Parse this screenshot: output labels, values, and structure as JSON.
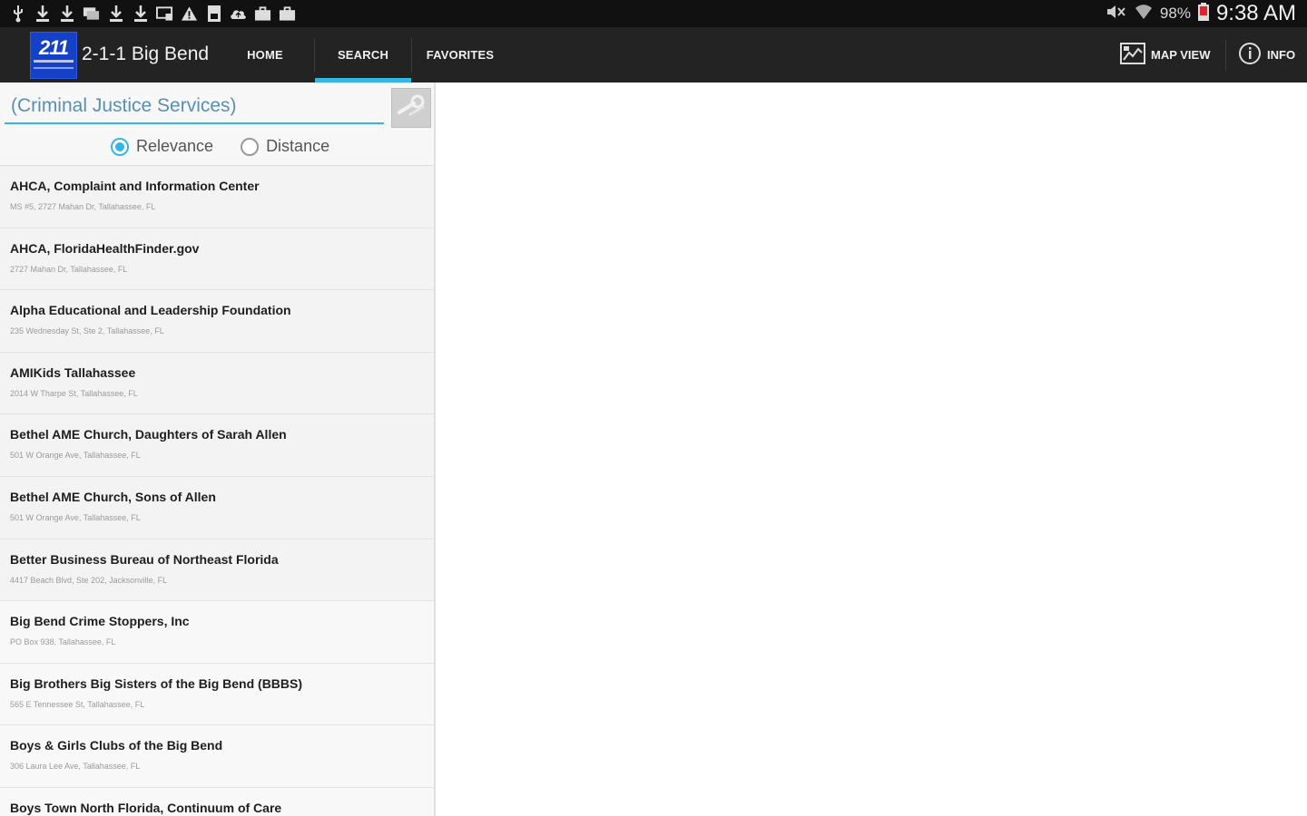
{
  "status_bar": {
    "icons": [
      "usb-icon",
      "download-icon",
      "download-icon",
      "messages-icon",
      "download-icon",
      "download-icon",
      "screen-cast-icon",
      "warning-icon",
      "sim-icon",
      "cloud-upload-icon",
      "briefcase-icon",
      "briefcase-icon"
    ],
    "battery_percent": "98%",
    "time": "9:38 AM"
  },
  "action_bar": {
    "logo_text": "211",
    "app_title": "2-1-1 Big Bend",
    "tabs": [
      {
        "label": "HOME",
        "selected": false
      },
      {
        "label": "SEARCH",
        "selected": true
      },
      {
        "label": "FAVORITES",
        "selected": false
      }
    ],
    "actions": {
      "map_view": "MAP VIEW",
      "info": "INFO"
    },
    "accent_color": "#33b5e5"
  },
  "search": {
    "value": "(Criminal Justice Services)",
    "sort_options": [
      {
        "label": "Relevance",
        "checked": true
      },
      {
        "label": "Distance",
        "checked": false
      }
    ]
  },
  "results": [
    {
      "name": "AHCA, Complaint and Information Center",
      "address": "MS #5, 2727 Mahan Dr, Tallahassee, FL"
    },
    {
      "name": "AHCA, FloridaHealthFinder.gov",
      "address": "2727 Mahan Dr, Tallahassee, FL"
    },
    {
      "name": "Alpha Educational and Leadership Foundation",
      "address": "235 Wednesday St, Ste 2, Tallahassee, FL"
    },
    {
      "name": "AMIKids Tallahassee",
      "address": "2014 W Tharpe St, Tallahassee, FL"
    },
    {
      "name": "Bethel AME Church, Daughters of Sarah Allen",
      "address": "501 W Orange Ave, Tallahassee, FL"
    },
    {
      "name": "Bethel AME Church, Sons of Allen",
      "address": "501 W Orange Ave, Tallahassee, FL"
    },
    {
      "name": "Better Business Bureau of Northeast Florida",
      "address": "4417 Beach Blvd, Ste 202, Jacksonville, FL"
    },
    {
      "name": "Big Bend Crime Stoppers, Inc",
      "address": "PO Box 938, Tallahassee, FL"
    },
    {
      "name": "Big Brothers Big Sisters of the Big Bend (BBBS)",
      "address": "565 E Tennessee St, Tallahassee, FL"
    },
    {
      "name": "Boys & Girls Clubs of the Big Bend",
      "address": "306 Laura Lee Ave, Tallahassee, FL"
    },
    {
      "name": "Boys Town North Florida, Continuum of Care",
      "address": ""
    }
  ]
}
